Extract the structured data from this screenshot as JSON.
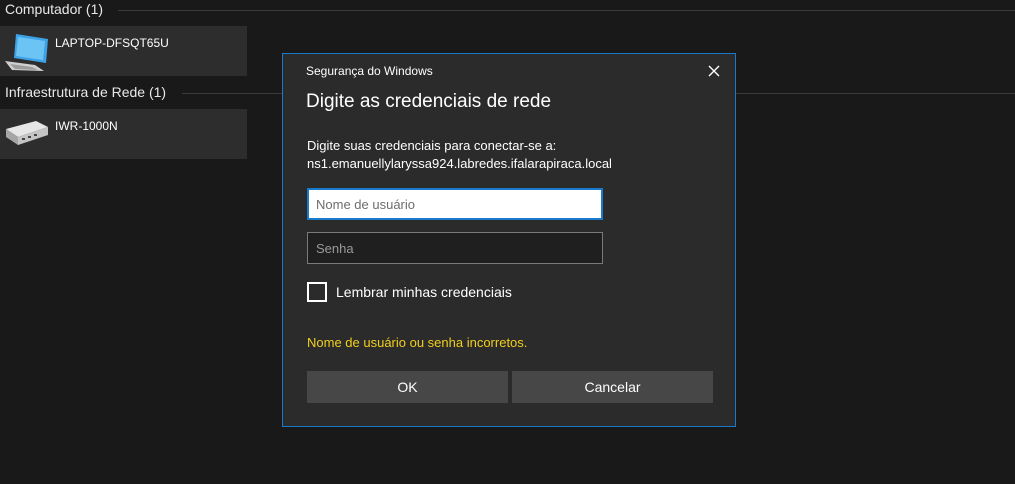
{
  "groups": [
    {
      "header": "Computador (1)",
      "items": [
        {
          "label": "LAPTOP-DFSQT65U",
          "icon": "computer-icon"
        }
      ]
    },
    {
      "header": "Infraestrutura de Rede (1)",
      "items": [
        {
          "label": "IWR-1000N",
          "icon": "router-icon"
        }
      ]
    }
  ],
  "dialog": {
    "caption": "Segurança do Windows",
    "title": "Digite as credenciais de rede",
    "prompt_line1": "Digite suas credenciais para conectar-se a:",
    "prompt_line2": "ns1.emanuellylaryssa924.labredes.ifalarapiraca.local",
    "username": {
      "value": "",
      "placeholder": "Nome de usuário"
    },
    "password": {
      "value": "",
      "placeholder": "Senha"
    },
    "remember_label": "Lembrar minhas credenciais",
    "remember_checked": false,
    "error": "Nome de usuário ou senha incorretos.",
    "ok_label": "OK",
    "cancel_label": "Cancelar",
    "accent_color": "#1979ca",
    "error_color": "#f2cf1d"
  }
}
